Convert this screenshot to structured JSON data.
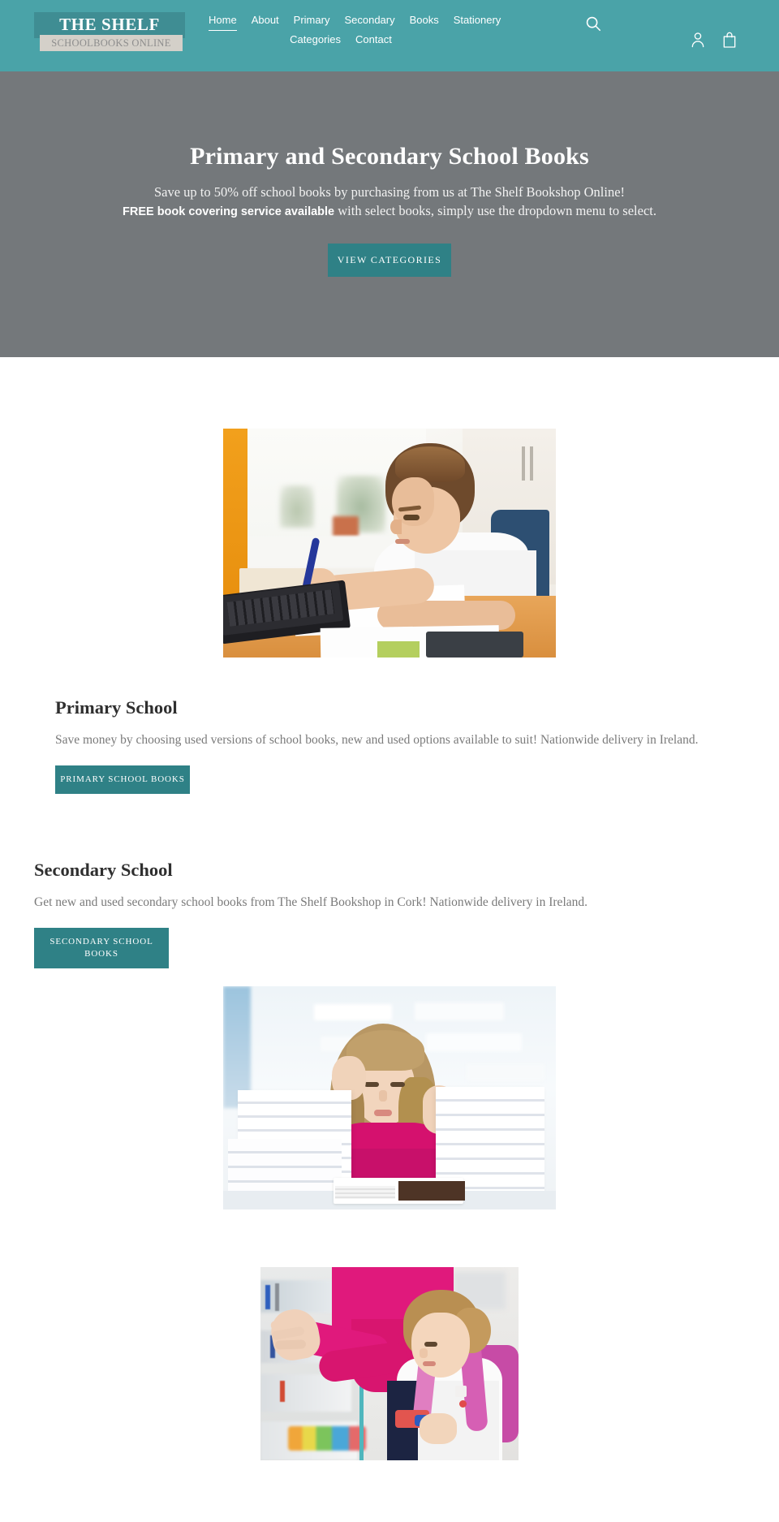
{
  "colors": {
    "header_teal": "#4aa3a8",
    "logo_box_teal": "#3f8d93",
    "logo_sub_grey": "#d4d0c9",
    "hero_grey": "#74787b",
    "button_teal": "#2f8186",
    "body_text_grey": "#7a7a7a",
    "heading_dark": "#2f2f2f"
  },
  "header": {
    "logo": {
      "title": "THE SHELF",
      "subtitle": "SCHOOLBOOKS ONLINE"
    },
    "nav": {
      "row1": [
        {
          "label": "Home",
          "active": true
        },
        {
          "label": "About",
          "active": false
        },
        {
          "label": "Primary",
          "active": false
        },
        {
          "label": "Secondary",
          "active": false
        },
        {
          "label": "Books",
          "active": false
        },
        {
          "label": "Stationery",
          "active": false
        }
      ],
      "row2": [
        {
          "label": "Categories",
          "active": false
        },
        {
          "label": "Contact",
          "active": false
        }
      ]
    },
    "icons": {
      "search": "search-icon",
      "account": "account-icon",
      "cart": "shopping-bag-icon"
    }
  },
  "hero": {
    "title": "Primary and Secondary School Books",
    "line1": "Save up to 50% off school books by purchasing from us at The Shelf Bookshop Online!",
    "line2_strong": "FREE book covering service available",
    "line2_rest": " with select books, simply use the dropdown menu to select.",
    "button_label": "VIEW CATEGORIES"
  },
  "sections": [
    {
      "id": "primary",
      "title": "Primary School",
      "body": "Save money by choosing used versions of school books, new and used options available to suit! Nationwide delivery in Ireland.",
      "button_label": "PRIMARY SCHOOL BOOKS",
      "image_alt": "boy-writing-at-desk-photo"
    },
    {
      "id": "secondary",
      "title": "Secondary School",
      "body": "Get new and used secondary school books from The Shelf Bookshop in Cork! Nationwide delivery in Ireland.",
      "button_label": "SECONDARY SCHOOL BOOKS",
      "image_alt": "girl-reading-between-book-stacks-photo"
    },
    {
      "id": "stationery",
      "title": "",
      "body": "",
      "button_label": "",
      "image_alt": "girl-and-adult-shopping-for-stationery-photo"
    }
  ]
}
